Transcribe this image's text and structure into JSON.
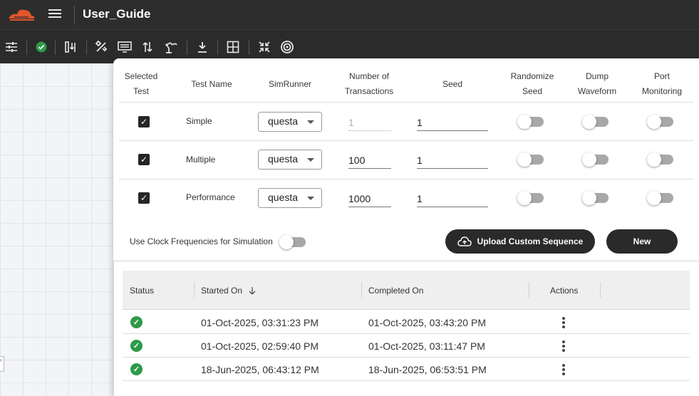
{
  "app": {
    "title": "User_Guide"
  },
  "toolbar": {
    "icons": [
      "sliders-icon",
      "check-circle-icon",
      "compare-icon",
      "tools-icon",
      "monitor-icon",
      "sort-arrows-icon",
      "robot-arm-icon",
      "download-icon",
      "grid-icon",
      "collapse-icon",
      "target-icon"
    ],
    "status_color": "#2e9a48"
  },
  "tests_table": {
    "headers": {
      "selected": "Selected Test",
      "name": "Test Name",
      "simrunner": "SimRunner",
      "transactions": "Number of Transactions",
      "seed": "Seed",
      "randomize": "Randomize Seed",
      "dump": "Dump Waveform",
      "port": "Port Monitoring"
    },
    "rows": [
      {
        "selected": true,
        "name": "Simple",
        "simrunner": "questa",
        "transactions": "1",
        "transactions_disabled": true,
        "seed": "1",
        "randomize": false,
        "dump": false,
        "port": false
      },
      {
        "selected": true,
        "name": "Multiple",
        "simrunner": "questa",
        "transactions": "100",
        "transactions_disabled": false,
        "seed": "1",
        "randomize": false,
        "dump": false,
        "port": false
      },
      {
        "selected": true,
        "name": "Performance",
        "simrunner": "questa",
        "transactions": "1000",
        "transactions_disabled": false,
        "seed": "1",
        "randomize": false,
        "dump": false,
        "port": false
      }
    ]
  },
  "options": {
    "clock_label": "Use Clock Frequencies for Simulation",
    "clock_enabled": false,
    "upload_label": "Upload Custom Sequence",
    "new_label": "New"
  },
  "history": {
    "headers": {
      "status": "Status",
      "started": "Started On",
      "completed": "Completed On",
      "actions": "Actions"
    },
    "sort": "started-descending",
    "rows": [
      {
        "status": "success",
        "started": "01-Oct-2025, 03:31:23 PM",
        "completed": "01-Oct-2025, 03:43:20 PM"
      },
      {
        "status": "success",
        "started": "01-Oct-2025, 02:59:40 PM",
        "completed": "01-Oct-2025, 03:11:47 PM"
      },
      {
        "status": "success",
        "started": "18-Jun-2025, 06:43:12 PM",
        "completed": "18-Jun-2025, 06:53:51 PM"
      }
    ]
  },
  "colors": {
    "titlebar": "#2d2d2d",
    "accent_logo": "#e0562b",
    "button_dark": "#2a2a2a",
    "success": "#2e9a48"
  }
}
